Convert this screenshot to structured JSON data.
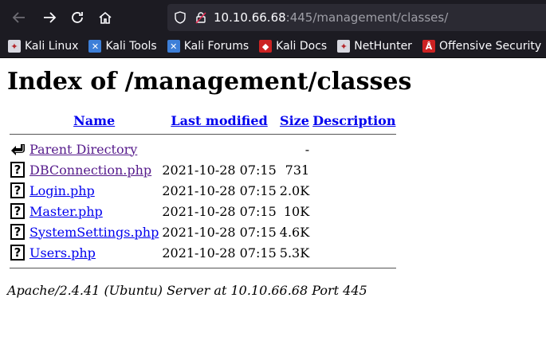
{
  "browser": {
    "url_host": "10.10.66.68",
    "url_rest": ":445/management/classes/",
    "bookmarks": [
      {
        "label": "Kali Linux",
        "icon": "kali-icon",
        "color": "#ffffff"
      },
      {
        "label": "Kali Tools",
        "icon": "kali-tools-icon",
        "color": "#ffffff"
      },
      {
        "label": "Kali Forums",
        "icon": "kali-forums-icon",
        "color": "#ffffff"
      },
      {
        "label": "Kali Docs",
        "icon": "kali-docs-icon",
        "color": "#cc2222"
      },
      {
        "label": "NetHunter",
        "icon": "nethunter-icon",
        "color": "#ffffff"
      },
      {
        "label": "Offensive Security",
        "icon": "offsec-icon",
        "color": "#cc2222"
      }
    ]
  },
  "page": {
    "title": "Index of /management/classes",
    "columns": {
      "name": "Name",
      "modified": "Last modified",
      "size": "Size",
      "description": "Description"
    },
    "parent": {
      "name": "Parent Directory",
      "size": "-"
    },
    "files": [
      {
        "name": "DBConnection.php",
        "modified": "2021-10-28 07:15",
        "size": "731",
        "visited": true
      },
      {
        "name": "Login.php",
        "modified": "2021-10-28 07:15",
        "size": "2.0K",
        "visited": false
      },
      {
        "name": "Master.php",
        "modified": "2021-10-28 07:15",
        "size": "10K",
        "visited": false
      },
      {
        "name": "SystemSettings.php",
        "modified": "2021-10-28 07:15",
        "size": "4.6K",
        "visited": false
      },
      {
        "name": "Users.php",
        "modified": "2021-10-28 07:15",
        "size": "5.3K",
        "visited": false
      }
    ],
    "footer": "Apache/2.4.41 (Ubuntu) Server at 10.10.66.68 Port 445"
  }
}
